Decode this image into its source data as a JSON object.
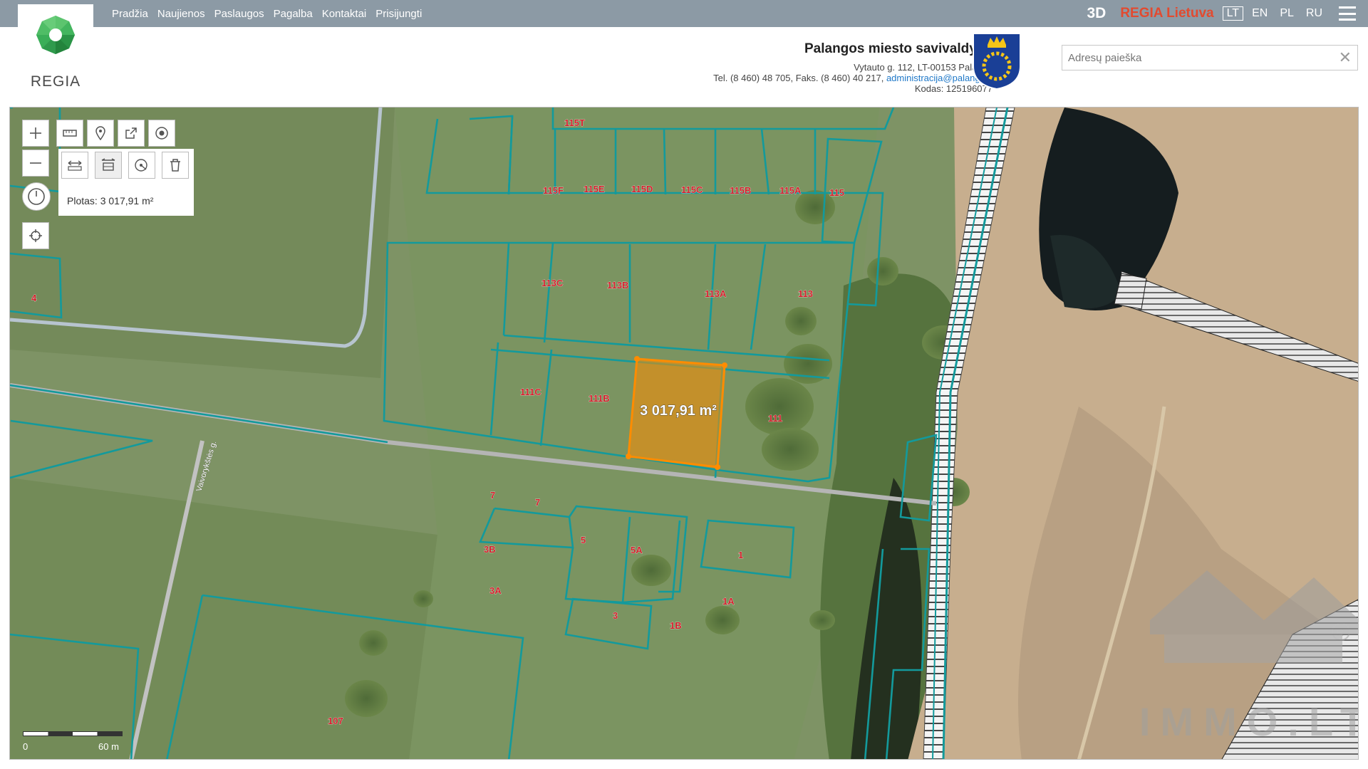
{
  "nav": {
    "links": [
      "Pradžia",
      "Naujienos",
      "Paslaugos",
      "Pagalba",
      "Kontaktai",
      "Prisijungti"
    ],
    "btn_3d": "3D",
    "regia_lietuva": "REGIA Lietuva",
    "languages": [
      "LT",
      "EN",
      "PL",
      "RU"
    ],
    "active_language": "LT"
  },
  "logo": {
    "text": "REGIA"
  },
  "municipality": {
    "name": "Palangos miesto savivaldybė",
    "address": "Vytauto g. 112, LT-00153 Palanga",
    "phones": "Tel. (8 460) 48 705, Faks. (8 460) 40 217,",
    "email": "administracija@palanga.lt",
    "code": "Kodas: 125196077"
  },
  "search": {
    "placeholder": "Adresų paieška"
  },
  "measure": {
    "label": "Plotas: 3 017,91 m²",
    "map_label": "3 017,91 m²"
  },
  "parcels": [
    "115T",
    "115F",
    "115E",
    "115D",
    "115C",
    "115B",
    "115A",
    "115",
    "113C",
    "113B",
    "113A",
    "113",
    "111C",
    "111B",
    "111",
    "4",
    "7",
    "7",
    "5",
    "5A",
    "1",
    "3B",
    "3A",
    "1A",
    "3",
    "1B",
    "107"
  ],
  "street": "Vaivorykštės g.",
  "scale": {
    "min": "0",
    "max": "60 m"
  },
  "watermark": {
    "text": "IMMO.LT"
  },
  "colors": {
    "topbar": "#8c9aa5",
    "accent": "#e24a2f",
    "parcel_line": "#169e9e",
    "measure": "#ff8c00"
  }
}
